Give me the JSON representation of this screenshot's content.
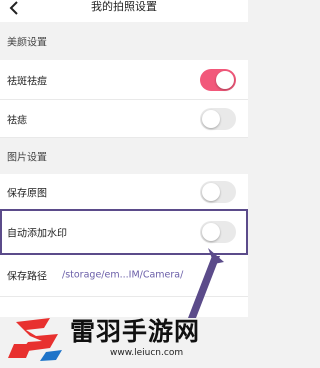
{
  "header": {
    "title": "我的拍照设置"
  },
  "sections": {
    "beauty": "美颜设置",
    "image": "图片设置"
  },
  "rows": {
    "freckle": {
      "label": "祛斑祛痘",
      "toggle": "on"
    },
    "mole": {
      "label": "祛痣",
      "toggle": "off"
    },
    "save_original": {
      "label": "保存原图",
      "toggle": "off"
    },
    "watermark": {
      "label": "自动添加水印",
      "toggle": "off"
    },
    "save_path": {
      "label": "保存路径",
      "value": "/storage/em...IM/Camera/"
    }
  },
  "watermark_overlay": {
    "name": "雷羽手游网",
    "url": "www.leiucn.com"
  },
  "colors": {
    "accent": "#f2587a",
    "highlight": "#5b4b8a",
    "path": "#6a5ea8"
  },
  "icons": {
    "back": "back-arrow-icon",
    "logo": "leiyu-logo-icon"
  }
}
